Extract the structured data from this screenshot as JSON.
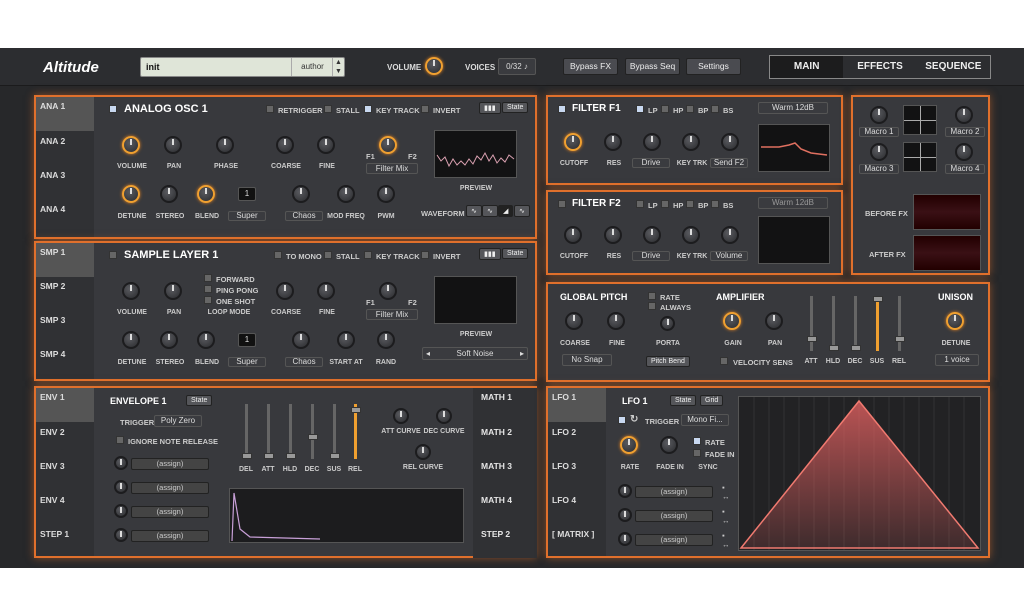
{
  "app": {
    "name": "Altitude",
    "preset": "init",
    "author": "author",
    "volume_label": "VOLUME",
    "voices_label": "VOICES",
    "voices": "0/32",
    "bypass_fx": "Bypass FX",
    "bypass_seq": "Bypass Seq",
    "settings": "Settings",
    "accent": "#e0702c"
  },
  "tabs": [
    "MAIN",
    "EFFECTS",
    "SEQUENCE"
  ],
  "osc": {
    "tabs": [
      "ANA 1",
      "ANA 2",
      "ANA 3",
      "ANA 4"
    ],
    "title": "ANALOG OSC 1",
    "retrigger": "RETRIGGER",
    "stall": "STALL",
    "key_track": "KEY TRACK",
    "invert": "INVERT",
    "state": "State",
    "volume": "VOLUME",
    "pan": "PAN",
    "phase": "PHASE",
    "coarse": "COARSE",
    "fine": "FINE",
    "f1": "F1",
    "f2": "F2",
    "filter_mix": "Filter Mix",
    "preview": "PREVIEW",
    "detune": "DETUNE",
    "stereo": "STEREO",
    "blend": "BLEND",
    "unison": "1",
    "super": "Super",
    "chaos": "Chaos",
    "mod_freq": "MOD FREQ",
    "pwm": "PWM",
    "waveform": "WAVEFORM"
  },
  "smp": {
    "tabs": [
      "SMP 1",
      "SMP 2",
      "SMP 3",
      "SMP 4"
    ],
    "title": "SAMPLE LAYER 1",
    "to_mono": "TO MONO",
    "stall": "STALL",
    "key_track": "KEY TRACK",
    "invert": "INVERT",
    "state": "State",
    "forward": "FORWARD",
    "ping_pong": "PING PONG",
    "one_shot": "ONE SHOT",
    "volume": "VOLUME",
    "pan": "PAN",
    "loop_mode": "LOOP MODE",
    "coarse": "COARSE",
    "fine": "FINE",
    "f1": "F1",
    "f2": "F2",
    "filter_mix": "Filter Mix",
    "preview": "PREVIEW",
    "detune": "DETUNE",
    "stereo": "STEREO",
    "blend": "BLEND",
    "unison": "1",
    "super": "Super",
    "chaos": "Chaos",
    "start_at": "START AT",
    "rand": "RAND",
    "sample": "Soft Noise"
  },
  "f1": {
    "title": "FILTER F1",
    "lp": "LP",
    "hp": "HP",
    "bp": "BP",
    "bs": "BS",
    "type": "Warm 12dB",
    "cutoff": "CUTOFF",
    "res": "RES",
    "drive": "Drive",
    "key_trk": "KEY TRK",
    "send": "Send F2"
  },
  "f2": {
    "title": "FILTER F2",
    "lp": "LP",
    "hp": "HP",
    "bp": "BP",
    "bs": "BS",
    "type": "Warm 12dB",
    "cutoff": "CUTOFF",
    "res": "RES",
    "drive": "Drive",
    "key_trk": "KEY TRK",
    "send": "Volume"
  },
  "macros": [
    "Macro 1",
    "Macro 2",
    "Macro 3",
    "Macro 4"
  ],
  "before_fx": "BEFORE FX",
  "after_fx": "AFTER FX",
  "pitch": {
    "title": "GLOBAL PITCH",
    "rate": "RATE",
    "always": "ALWAYS",
    "coarse": "COARSE",
    "fine": "FINE",
    "porta": "PORTA",
    "snap": "No Snap",
    "pitch_bend": "Pitch Bend"
  },
  "amp": {
    "title": "AMPLIFIER",
    "gain": "GAIN",
    "pan": "PAN",
    "vel": "VELOCITY SENS",
    "att": "ATT",
    "hld": "HLD",
    "dec": "DEC",
    "sus": "SUS",
    "rel": "REL"
  },
  "unison": {
    "title": "UNISON",
    "detune": "DETUNE",
    "voices": "1 voice"
  },
  "env": {
    "tabs": [
      "ENV 1",
      "ENV 2",
      "ENV 3",
      "ENV 4",
      "STEP 1"
    ],
    "title": "ENVELOPE 1",
    "state": "State",
    "trigger": "TRIGGER",
    "trigger_val": "Poly Zero",
    "ignore": "IGNORE NOTE RELEASE",
    "assign": "(assign)",
    "del": "DEL",
    "att": "ATT",
    "hld": "HLD",
    "dec": "DEC",
    "sus": "SUS",
    "rel": "REL",
    "att_curve": "ATT CURVE",
    "dec_curve": "DEC CURVE",
    "rel_curve": "REL CURVE",
    "math": [
      "MATH 1",
      "MATH 2",
      "MATH 3",
      "MATH 4",
      "STEP 2"
    ]
  },
  "lfo": {
    "tabs": [
      "LFO 1",
      "LFO 2",
      "LFO 3",
      "LFO 4",
      "[ MATRIX ]"
    ],
    "title": "LFO 1",
    "state": "State",
    "grid": "Grid",
    "trigger": "TRIGGER",
    "trigger_val": "Mono Fi...",
    "rate": "RATE",
    "fade_in": "FADE IN",
    "sync": "SYNC",
    "rate_cb": "RATE",
    "fade_cb": "FADE IN",
    "assign": "(assign)"
  }
}
